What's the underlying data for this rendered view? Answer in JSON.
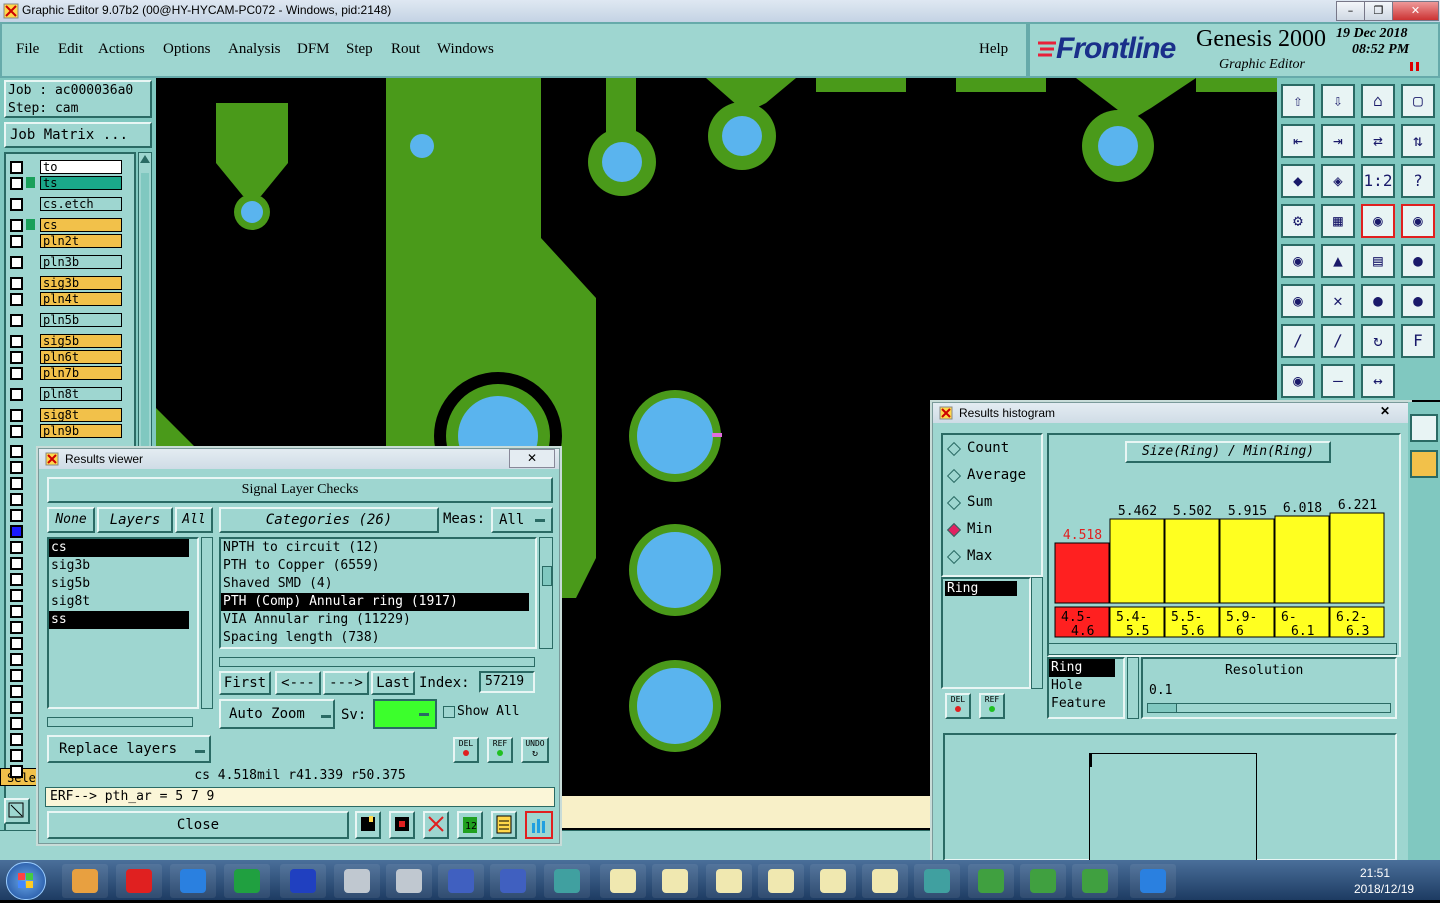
{
  "window": {
    "title": "Graphic Editor 9.07b2 (00@HY-HYCAM-PC072 - Windows, pid:2148)"
  },
  "menu": [
    "File",
    "Edit",
    "Actions",
    "Options",
    "Analysis",
    "DFM",
    "Step",
    "Rout",
    "Windows"
  ],
  "help": "Help",
  "brand": {
    "logo": "Frontline",
    "product": "Genesis 2000",
    "subtitle": "Graphic Editor",
    "date": "19 Dec 2018",
    "time": "08:52 PM"
  },
  "job": {
    "job_label": "Job  : ac000036a0",
    "step_label": "Step: cam",
    "matrix_button": "Job Matrix ..."
  },
  "layers": [
    "to",
    "ts",
    "cs.etch",
    "cs",
    "pln2t",
    "pln3b",
    "sig3b",
    "pln4t",
    "pln5b",
    "sig5b",
    "pln6t",
    "pln7b",
    "pln8t",
    "sig8t",
    "pln9b"
  ],
  "layer_colors": {
    "to": "#ffffff",
    "ts": "#1aa88a",
    "cs.etch": "#9ed6d0",
    "cs": "#f2c14a",
    "pln2t": "#f2c14a",
    "pln3b": "#9ed6d0",
    "sig3b": "#f2c14a",
    "pln4t": "#f2c14a",
    "pln5b": "#9ed6d0",
    "sig5b": "#f2c14a",
    "pln6t": "#f2c14a",
    "pln7b": "#f2c14a",
    "pln8t": "#9ed6d0",
    "sig8t": "#f2c14a",
    "pln9b": "#f2c14a"
  },
  "select_label": "Selec",
  "results_viewer": {
    "title": "Results viewer",
    "heading": "Signal Layer Checks",
    "none": "None",
    "layers": "Layers",
    "all": "All",
    "categories_label": "Categories (26)",
    "meas_label": "Meas:",
    "meas_value": "All",
    "layer_list": [
      "cs",
      "sig3b",
      "sig5b",
      "sig8t",
      "ss"
    ],
    "category_list": [
      "NPTH to circuit (12)",
      "PTH to Copper (6559)",
      "Shaved SMD (4)",
      "PTH (Comp) Annular ring (1917)",
      "VIA Annular ring (11229)",
      "Spacing length (738)"
    ],
    "nav": {
      "first": "First",
      "prev": "<---",
      "next": "--->",
      "last": "Last",
      "index_label": "Index:",
      "index_value": "57219"
    },
    "auto_zoom": "Auto Zoom",
    "sv_label": "Sv:",
    "show_all": "Show All",
    "replace_layers": "Replace layers",
    "icon_labels": {
      "del": "DEL",
      "ref": "REF",
      "undo": "UNDO"
    },
    "status": "cs 4.518mil   r41.339   r50.375",
    "erf": "ERF--> pth_ar = 5 7 9",
    "close": "Close"
  },
  "histogram": {
    "title": "Results histogram",
    "options": [
      "Count",
      "Average",
      "Sum",
      "Min",
      "Max"
    ],
    "selected_option": "Min",
    "header": "Size(Ring) / Min(Ring)",
    "left_list": [
      "Ring"
    ],
    "bottom_list": [
      "Ring",
      "Hole",
      "Feature"
    ],
    "resolution_label": "Resolution",
    "resolution_value": "0.1",
    "icon_labels": {
      "del": "DEL",
      "ref": "REF"
    }
  },
  "chart_data": {
    "type": "bar",
    "title": "Size(Ring) / Min(Ring)",
    "categories": [
      "4.5-4.6",
      "5.4-5.5",
      "5.5-5.6",
      "5.9-6",
      "6-6.1",
      "6.2-6.3"
    ],
    "values": [
      4.518,
      5.462,
      5.502,
      5.915,
      6.018,
      6.221
    ],
    "colors": [
      "#ff2020",
      "#ffff20",
      "#ffff20",
      "#ffff20",
      "#ffff20",
      "#ffff20"
    ],
    "bar_heights": [
      1,
      1.4,
      1.4,
      1.4,
      1.45,
      1.5
    ]
  },
  "taskbar": {
    "time": "21:51",
    "date": "2018/12/19"
  }
}
